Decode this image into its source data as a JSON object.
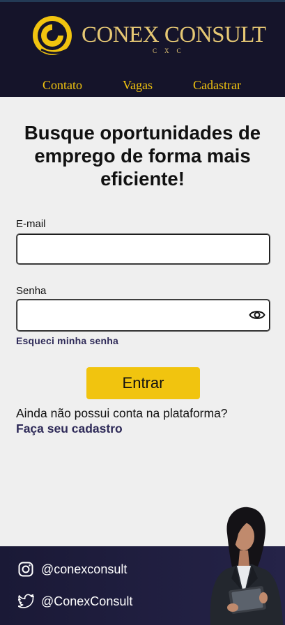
{
  "brand": {
    "name": "CONEX CONSULT",
    "tagline": "CXC",
    "colors": {
      "header_bg": "#15142a",
      "gold": "#f1c40f",
      "logo_gold": "#e6c874",
      "link": "#2e2a58",
      "footer_bg": "#1f1d40"
    }
  },
  "nav": {
    "items": [
      {
        "label": "Contato"
      },
      {
        "label": "Vagas"
      },
      {
        "label": "Cadastrar"
      }
    ]
  },
  "main": {
    "headline": "Busque oportunidades de emprego de forma mais eficiente!",
    "email": {
      "label": "E-mail",
      "value": "",
      "placeholder": ""
    },
    "password": {
      "label": "Senha",
      "value": "",
      "placeholder": "",
      "toggle_icon": "eye-icon"
    },
    "forgot_link": "Esqueci minha senha",
    "submit_label": "Entrar",
    "no_account_text": "Ainda não possui conta na plataforma?",
    "signup_link": "Faça seu cadastro"
  },
  "footer": {
    "social": [
      {
        "icon": "instagram-icon",
        "handle": "@conexconsult"
      },
      {
        "icon": "twitter-icon",
        "handle": "@ConexConsult"
      }
    ]
  }
}
